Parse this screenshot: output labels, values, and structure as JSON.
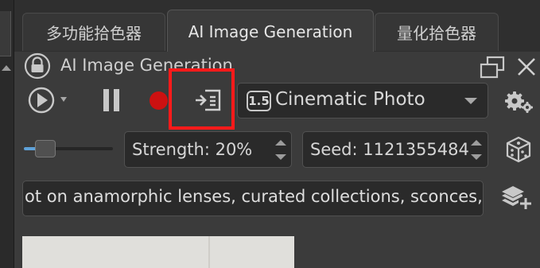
{
  "tabs": [
    {
      "label": "多功能拾色器",
      "active": false
    },
    {
      "label": "AI Image Generation",
      "active": true
    },
    {
      "label": "量化拾色器",
      "active": false
    }
  ],
  "panel": {
    "title": "AI Image Generation"
  },
  "toolbar": {
    "style_version": "1.5",
    "style_label": "Cinematic Photo"
  },
  "controls": {
    "strength_text": "Strength: 20%",
    "strength_value": 0.2,
    "seed_text": "Seed: 1121355484"
  },
  "prompt": {
    "text": "ot on anamorphic lenses, curated collections, sconces,"
  },
  "colors": {
    "record": "#cc1111",
    "highlight": "#ff1a1a",
    "slider_fill": "#5fa2d9"
  },
  "icons": [
    "lock-icon",
    "float-window-icon",
    "close-icon",
    "play-icon",
    "chevron-down-icon",
    "pause-icon",
    "record-icon",
    "insert-layer-icon",
    "settings-icon",
    "dice-icon",
    "add-layers-icon"
  ]
}
